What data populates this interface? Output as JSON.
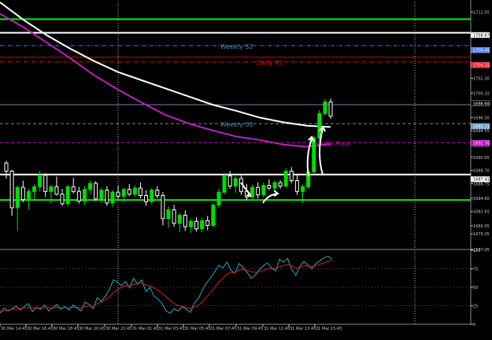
{
  "chart_data": [
    {
      "type": "line",
      "title": "",
      "xlabel": "",
      "ylabel": "",
      "ylim": [
        1677.05,
        1713.6
      ],
      "grid": true,
      "y_ticks": [
        "1712.05",
        "1708.67",
        "1706.45",
        "1704.25",
        "1702.30",
        "1700.10",
        "1698.60",
        "1696.50",
        "1694.55",
        "1692.45",
        "1690.65",
        "1688.70",
        "1686.75",
        "1684.60",
        "1682.65",
        "1680.55",
        "1679.35",
        "1677.05"
      ],
      "price_tags": [
        {
          "text": "1708.67",
          "value": 1708.67,
          "color": "#ffffff"
        },
        {
          "text": "1706.45",
          "value": 1706.45,
          "color": "#4f80ff"
        },
        {
          "text": "1704.25",
          "value": 1704.25,
          "color": "#ff2020"
        },
        {
          "text": "1698.60",
          "value": 1698.6,
          "color": "#000000"
        },
        {
          "text": "1695.23",
          "value": 1695.23,
          "color": "#6f9fcf"
        },
        {
          "text": "1692.76",
          "value": 1692.76,
          "color": "#cc00cc"
        },
        {
          "text": "1687.41",
          "value": 1687.41,
          "color": "#ffffff"
        }
      ],
      "levels": [
        {
          "name": "",
          "value": 1711.0,
          "color": "#00ee00",
          "style": "solid",
          "width": 2
        },
        {
          "name": "",
          "value": 1709.0,
          "color": "#ffffff",
          "style": "solid",
          "width": 2
        },
        {
          "name": "Weekly S2",
          "value": 1707.1,
          "color": "#4f7fbf",
          "style": "dashdot",
          "width": 1
        },
        {
          "name": "",
          "value": 1705.4,
          "color": "#cc0000",
          "style": "solid",
          "width": 1
        },
        {
          "name": "Daily R1",
          "value": 1704.7,
          "color": "#ee0000",
          "style": "dashdot",
          "width": 1
        },
        {
          "name": "",
          "value": 1698.4,
          "color": "#6e89a3",
          "style": "solid",
          "width": 1
        },
        {
          "name": "Weekly S3",
          "value": 1695.6,
          "color": "#8a8a8a",
          "style": "dashed",
          "width": 1
        },
        {
          "name": "Daily Pivot",
          "value": 1692.8,
          "color": "#cc00cc",
          "style": "dashed",
          "width": 1
        },
        {
          "name": "",
          "value": 1688.1,
          "color": "#ffffff",
          "style": "solid",
          "width": 2
        },
        {
          "name": "",
          "value": 1684.35,
          "color": "#00ee00",
          "style": "solid",
          "width": 2
        }
      ],
      "series": [
        {
          "name": "",
          "color": "#ffffff",
          "points": [
            [
              0,
              1713.5
            ],
            [
              30,
              1710.9
            ],
            [
              60,
              1708.6
            ],
            [
              90,
              1706.6
            ],
            [
              120,
              1704.8
            ],
            [
              150,
              1703.2
            ],
            [
              180,
              1702.0
            ],
            [
              210,
              1700.8
            ],
            [
              240,
              1699.6
            ],
            [
              270,
              1698.4
            ],
            [
              300,
              1697.5
            ],
            [
              330,
              1696.5
            ],
            [
              360,
              1695.8
            ],
            [
              390,
              1695.3
            ],
            [
              420,
              1695.1
            ]
          ]
        },
        {
          "name": "",
          "color": "#c020c0",
          "points": [
            [
              0,
              1711.8
            ],
            [
              30,
              1709.8
            ],
            [
              60,
              1707.5
            ],
            [
              90,
              1705.2
            ],
            [
              120,
              1702.7
            ],
            [
              150,
              1700.6
            ],
            [
              180,
              1698.7
            ],
            [
              210,
              1696.9
            ],
            [
              240,
              1695.6
            ],
            [
              270,
              1694.6
            ],
            [
              300,
              1693.7
            ],
            [
              330,
              1693.2
            ],
            [
              360,
              1692.5
            ],
            [
              390,
              1692.2
            ],
            [
              420,
              1692.6
            ]
          ]
        }
      ],
      "candles": [
        [
          1689.8,
          1690.1,
          1687.5,
          1688.6
        ],
        [
          1688.6,
          1688.8,
          1682.0,
          1683.2
        ],
        [
          1683.2,
          1686.5,
          1679.8,
          1686.2
        ],
        [
          1686.2,
          1687.2,
          1684.0,
          1684.4
        ],
        [
          1684.4,
          1686.0,
          1682.9,
          1685.6
        ],
        [
          1685.6,
          1686.7,
          1684.3,
          1686.3
        ],
        [
          1686.3,
          1688.7,
          1685.6,
          1688.0
        ],
        [
          1688.0,
          1688.3,
          1684.8,
          1685.6
        ],
        [
          1685.6,
          1686.6,
          1683.8,
          1686.3
        ],
        [
          1686.3,
          1687.8,
          1685.0,
          1685.2
        ],
        [
          1685.2,
          1686.0,
          1683.5,
          1683.8
        ],
        [
          1683.8,
          1686.6,
          1683.4,
          1686.3
        ],
        [
          1686.3,
          1687.6,
          1685.3,
          1685.6
        ],
        [
          1685.6,
          1686.3,
          1683.8,
          1684.2
        ],
        [
          1684.2,
          1686.4,
          1683.6,
          1685.9
        ],
        [
          1685.9,
          1687.2,
          1685.2,
          1686.8
        ],
        [
          1686.8,
          1687.1,
          1684.2,
          1684.5
        ],
        [
          1684.5,
          1686.2,
          1683.9,
          1685.8
        ],
        [
          1685.8,
          1686.4,
          1683.5,
          1683.9
        ],
        [
          1683.9,
          1685.8,
          1683.3,
          1685.5
        ],
        [
          1685.5,
          1686.5,
          1684.5,
          1684.9
        ],
        [
          1684.9,
          1686.2,
          1684.0,
          1685.9
        ],
        [
          1685.9,
          1686.7,
          1684.9,
          1685.2
        ],
        [
          1685.2,
          1686.5,
          1684.8,
          1686.1
        ],
        [
          1686.1,
          1686.9,
          1684.6,
          1685.0
        ],
        [
          1685.0,
          1685.8,
          1683.5,
          1684.1
        ],
        [
          1684.1,
          1686.1,
          1683.7,
          1685.8
        ],
        [
          1685.8,
          1686.4,
          1684.6,
          1685.0
        ],
        [
          1685.0,
          1685.5,
          1680.6,
          1681.6
        ],
        [
          1681.6,
          1683.4,
          1680.3,
          1682.9
        ],
        [
          1682.9,
          1683.6,
          1680.4,
          1680.9
        ],
        [
          1680.9,
          1682.5,
          1679.6,
          1682.1
        ],
        [
          1682.1,
          1682.8,
          1679.8,
          1680.4
        ],
        [
          1680.4,
          1681.6,
          1679.5,
          1681.2
        ],
        [
          1681.2,
          1681.8,
          1679.7,
          1680.1
        ],
        [
          1680.1,
          1681.7,
          1679.6,
          1681.3
        ],
        [
          1681.3,
          1682.0,
          1679.9,
          1680.6
        ],
        [
          1680.6,
          1683.9,
          1680.3,
          1683.6
        ],
        [
          1683.6,
          1686.0,
          1683.2,
          1685.5
        ],
        [
          1685.5,
          1688.3,
          1685.2,
          1687.9
        ],
        [
          1687.9,
          1688.6,
          1686.0,
          1686.4
        ],
        [
          1686.4,
          1688.1,
          1685.4,
          1687.5
        ],
        [
          1687.5,
          1688.2,
          1685.1,
          1685.6
        ],
        [
          1685.6,
          1686.7,
          1684.3,
          1684.8
        ],
        [
          1684.8,
          1686.6,
          1684.5,
          1686.2
        ],
        [
          1686.2,
          1686.9,
          1684.6,
          1685.1
        ],
        [
          1685.1,
          1686.9,
          1684.7,
          1686.5
        ],
        [
          1686.5,
          1687.4,
          1685.8,
          1686.1
        ],
        [
          1686.1,
          1687.2,
          1685.7,
          1686.9
        ],
        [
          1686.9,
          1687.3,
          1686.0,
          1686.4
        ],
        [
          1686.4,
          1689.0,
          1686.2,
          1688.6
        ],
        [
          1688.6,
          1689.2,
          1686.8,
          1687.2
        ],
        [
          1687.2,
          1688.1,
          1685.1,
          1685.6
        ],
        [
          1685.6,
          1686.6,
          1683.9,
          1686.3
        ],
        [
          1686.3,
          1688.8,
          1686.0,
          1688.5
        ],
        [
          1688.5,
          1693.8,
          1688.2,
          1693.5
        ],
        [
          1693.5,
          1697.6,
          1693.1,
          1697.1
        ],
        [
          1697.1,
          1699.2,
          1696.8,
          1698.8
        ],
        [
          1698.8,
          1699.3,
          1696.3,
          1696.7
        ]
      ]
    },
    {
      "type": "line",
      "title": "",
      "xlabel": "",
      "ylabel": "",
      "ylim": [
        0,
        100
      ],
      "y_ticks": [
        "100",
        "75",
        "50",
        "25",
        "0"
      ],
      "series": [
        {
          "name": "",
          "color": "#2aa7c4",
          "values": [
            15,
            22,
            18,
            21,
            25,
            19,
            24,
            28,
            17,
            23,
            20,
            26,
            18,
            22,
            27,
            20,
            24,
            19,
            26,
            22,
            18,
            30,
            27,
            21,
            36,
            31,
            38,
            47,
            60,
            57,
            52,
            58,
            49,
            62,
            54,
            60,
            44,
            50,
            38,
            34,
            28,
            18,
            15,
            21,
            18,
            24,
            20,
            16,
            29,
            35,
            47,
            56,
            63,
            71,
            80,
            76,
            84,
            73,
            69,
            82,
            77,
            70,
            62,
            66,
            74,
            79,
            83,
            76,
            72,
            88,
            84,
            89,
            74,
            66,
            78,
            85,
            80,
            75,
            82,
            86,
            90,
            92,
            88
          ]
        },
        {
          "name": "",
          "color": "#dd1d1d",
          "values": [
            17,
            18,
            19,
            20,
            21,
            21,
            22,
            23,
            22,
            22,
            22,
            23,
            22,
            22,
            23,
            22,
            23,
            22,
            23,
            23,
            22,
            24,
            25,
            24,
            28,
            30,
            33,
            37,
            43,
            47,
            50,
            52,
            51,
            54,
            55,
            56,
            53,
            52,
            49,
            46,
            42,
            37,
            32,
            28,
            25,
            24,
            23,
            21,
            23,
            26,
            31,
            37,
            43,
            50,
            57,
            62,
            68,
            70,
            70,
            73,
            74,
            73,
            71,
            70,
            71,
            73,
            75,
            76,
            75,
            78,
            79,
            81,
            79,
            76,
            77,
            79,
            79,
            78,
            79,
            81,
            83,
            85,
            86
          ]
        }
      ]
    }
  ],
  "x_ticks": [
    "30 Mar 14:45",
    "30 Mar 16:45",
    "30 Mar 18:45",
    "30 Mar 20:45",
    "30 Mar 22:45",
    "31 Mar 01:45",
    "31 Mar 03:45",
    "31 Mar 05:45",
    "31 Mar 07:45",
    "31 Mar 09:45",
    "31 Mar 11:45",
    "31 Mar 13:45",
    "31 Mar 15:45"
  ],
  "colors": {
    "background": "#000000",
    "bull": "#00dd00",
    "bear": "#ffffff",
    "axis": "#c8c8c8",
    "grid": "#555555"
  }
}
